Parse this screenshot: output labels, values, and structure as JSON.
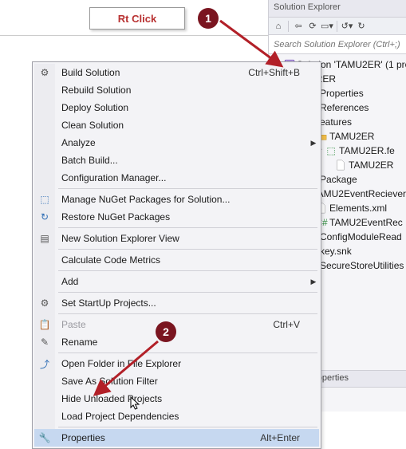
{
  "callout": {
    "text": "Rt Click"
  },
  "badges": {
    "b1": "1",
    "b2": "2"
  },
  "solutionExplorer": {
    "title": "Solution Explorer",
    "searchPlaceholder": "Search Solution Explorer (Ctrl+;)",
    "tree": {
      "solution": "Solution 'TAMU2ER' (1 pro",
      "proj": "U2ER",
      "props": "Properties",
      "refs": "References",
      "features": "eatures",
      "feat1": "TAMU2ER",
      "feat1file": "TAMU2ER.fe",
      "feat1template": "TAMU2ER",
      "package": "Package",
      "recv": "TAMU2EventReciever",
      "elements": "Elements.xml",
      "recvcs": "TAMU2EventRec",
      "cfgmod": "ConfigModuleRead",
      "key": "key.snk",
      "ssutil": "SecureStoreUtilities"
    },
    "propPanelTitle": "Solution Properties"
  },
  "contextMenu": {
    "buildSolution": {
      "label": "Build Solution",
      "shortcut": "Ctrl+Shift+B"
    },
    "rebuildSolution": "Rebuild Solution",
    "deploySolution": "Deploy Solution",
    "cleanSolution": "Clean Solution",
    "analyze": "Analyze",
    "batchBuild": "Batch Build...",
    "configManager": "Configuration Manager...",
    "manageNuget": "Manage NuGet Packages for Solution...",
    "restoreNuget": "Restore NuGet Packages",
    "newSEView": "New Solution Explorer View",
    "calcMetrics": "Calculate Code Metrics",
    "add": "Add",
    "setStartup": "Set StartUp Projects...",
    "paste": {
      "label": "Paste",
      "shortcut": "Ctrl+V"
    },
    "rename": "Rename",
    "openInExplorer": "Open Folder in File Explorer",
    "saveAsFilter": "Save As Solution Filter",
    "hideUnloaded": "Hide Unloaded Projects",
    "loadDeps": "Load Project Dependencies",
    "properties": {
      "label": "Properties",
      "shortcut": "Alt+Enter"
    }
  }
}
